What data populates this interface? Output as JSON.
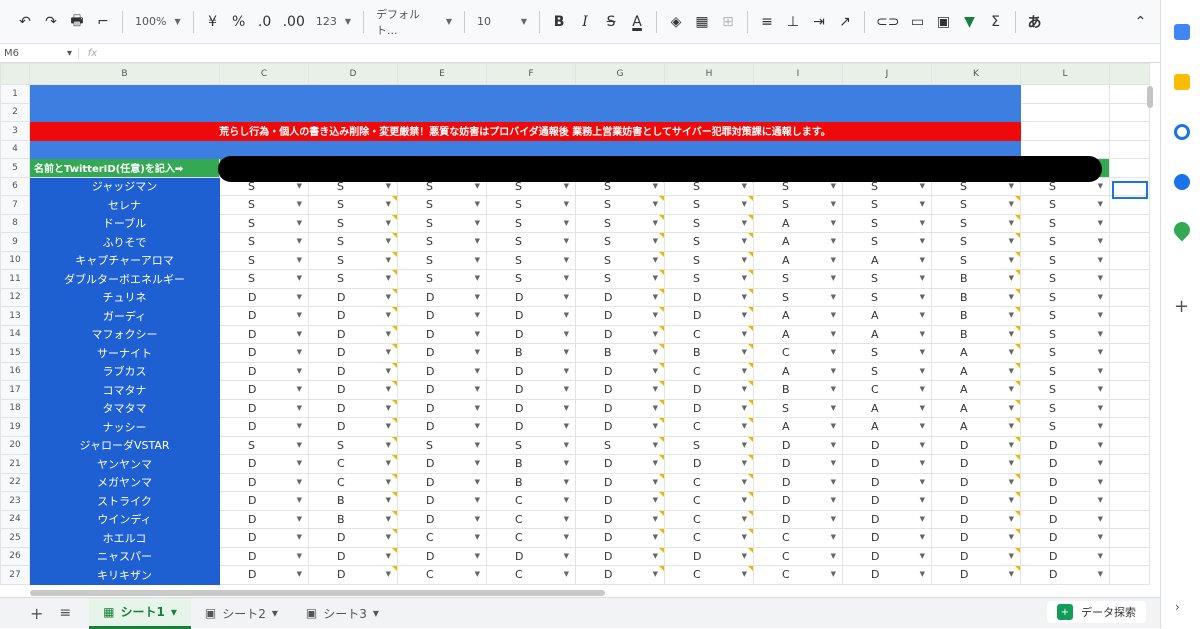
{
  "toolbar": {
    "undo": "↶",
    "redo": "↷",
    "print": "🖶",
    "paint_format": "⌐",
    "zoom": "100%",
    "currency": "¥",
    "percent": "%",
    "dec_less": ".0",
    "dec_more": ".00",
    "num_format": "123",
    "font": "デフォルト...",
    "font_size": "10",
    "bold": "B",
    "italic": "I",
    "strike": "S",
    "text_color": "A",
    "functions": "Σ",
    "input_tools": "あ",
    "collapse": "⌃"
  },
  "formula_bar": {
    "name_box": "M6",
    "fx": "fx"
  },
  "columns": [
    "B",
    "C",
    "D",
    "E",
    "F",
    "G",
    "H",
    "I",
    "J",
    "K",
    "L"
  ],
  "banner": {
    "warning": "荒らし行為・個人の書き込み削除・変更厳禁！悪質な妨害はプロバイダ通報後 業務上営業妨害としてサイバー犯罪対策課に通報します。",
    "header": "名前とTwitterID(任意)を記入➡"
  },
  "rows": [
    {
      "num": "6",
      "name": "ジャッジマン",
      "vals": [
        "S",
        "S",
        "S",
        "S",
        "S",
        "S",
        "S",
        "S",
        "S",
        "S"
      ]
    },
    {
      "num": "7",
      "name": "セレナ",
      "vals": [
        "S",
        "S",
        "S",
        "S",
        "S",
        "S",
        "S",
        "S",
        "S",
        "S"
      ]
    },
    {
      "num": "8",
      "name": "ドーブル",
      "vals": [
        "S",
        "S",
        "S",
        "S",
        "S",
        "S",
        "A",
        "S",
        "S",
        "S"
      ]
    },
    {
      "num": "9",
      "name": "ふりそで",
      "vals": [
        "S",
        "S",
        "S",
        "S",
        "S",
        "S",
        "A",
        "S",
        "S",
        "S"
      ]
    },
    {
      "num": "10",
      "name": "キャプチャーアロマ",
      "vals": [
        "S",
        "S",
        "S",
        "S",
        "S",
        "S",
        "A",
        "A",
        "S",
        "S"
      ]
    },
    {
      "num": "11",
      "name": "ダブルターボエネルギー",
      "vals": [
        "S",
        "S",
        "S",
        "S",
        "S",
        "S",
        "S",
        "S",
        "B",
        "S"
      ]
    },
    {
      "num": "12",
      "name": "チュリネ",
      "vals": [
        "D",
        "D",
        "D",
        "D",
        "D",
        "D",
        "S",
        "S",
        "B",
        "S"
      ]
    },
    {
      "num": "13",
      "name": "ガーディ",
      "vals": [
        "D",
        "D",
        "D",
        "D",
        "D",
        "D",
        "A",
        "A",
        "B",
        "S"
      ]
    },
    {
      "num": "14",
      "name": "マフォクシー",
      "vals": [
        "D",
        "D",
        "D",
        "D",
        "D",
        "C",
        "A",
        "A",
        "B",
        "S"
      ]
    },
    {
      "num": "15",
      "name": "サーナイト",
      "vals": [
        "D",
        "D",
        "D",
        "B",
        "B",
        "B",
        "C",
        "S",
        "A",
        "S"
      ]
    },
    {
      "num": "16",
      "name": "ラブカス",
      "vals": [
        "D",
        "D",
        "D",
        "D",
        "D",
        "C",
        "A",
        "S",
        "A",
        "S"
      ]
    },
    {
      "num": "17",
      "name": "コマタナ",
      "vals": [
        "D",
        "D",
        "D",
        "D",
        "D",
        "D",
        "B",
        "C",
        "A",
        "S"
      ]
    },
    {
      "num": "18",
      "name": "タマタマ",
      "vals": [
        "D",
        "D",
        "D",
        "D",
        "D",
        "D",
        "S",
        "A",
        "A",
        "S"
      ]
    },
    {
      "num": "19",
      "name": "ナッシー",
      "vals": [
        "D",
        "D",
        "D",
        "D",
        "D",
        "C",
        "A",
        "A",
        "A",
        "S"
      ]
    },
    {
      "num": "20",
      "name": "ジャローダVSTAR",
      "vals": [
        "S",
        "S",
        "S",
        "S",
        "S",
        "S",
        "D",
        "D",
        "D",
        "D"
      ]
    },
    {
      "num": "21",
      "name": "ヤンヤンマ",
      "vals": [
        "D",
        "C",
        "D",
        "B",
        "D",
        "D",
        "D",
        "D",
        "D",
        "D"
      ]
    },
    {
      "num": "22",
      "name": "メガヤンマ",
      "vals": [
        "D",
        "C",
        "D",
        "B",
        "D",
        "C",
        "D",
        "D",
        "D",
        "D"
      ]
    },
    {
      "num": "23",
      "name": "ストライク",
      "vals": [
        "D",
        "B",
        "D",
        "C",
        "D",
        "C",
        "D",
        "D",
        "D",
        "D"
      ]
    },
    {
      "num": "24",
      "name": "ウインディ",
      "vals": [
        "D",
        "B",
        "D",
        "C",
        "D",
        "C",
        "D",
        "D",
        "D",
        "D"
      ]
    },
    {
      "num": "25",
      "name": "ホエルコ",
      "vals": [
        "D",
        "D",
        "C",
        "C",
        "D",
        "C",
        "C",
        "D",
        "D",
        "D"
      ]
    },
    {
      "num": "26",
      "name": "ニャスパー",
      "vals": [
        "D",
        "D",
        "D",
        "D",
        "D",
        "D",
        "C",
        "D",
        "D",
        "D"
      ]
    },
    {
      "num": "27",
      "name": "キリキザン",
      "vals": [
        "D",
        "D",
        "C",
        "C",
        "D",
        "C",
        "C",
        "D",
        "D",
        "D"
      ]
    }
  ],
  "tabs": [
    {
      "label": "シート1",
      "active": true
    },
    {
      "label": "シート2",
      "active": false
    },
    {
      "label": "シート3",
      "active": false
    }
  ],
  "tabbar": {
    "add": "+",
    "all_sheets": "≡",
    "explore": "データ探索"
  },
  "colors": {
    "name_col": "#1e5fd2",
    "warning": "#ee0a0a",
    "header_green": "#34a853",
    "accent": "#1a73e8"
  }
}
